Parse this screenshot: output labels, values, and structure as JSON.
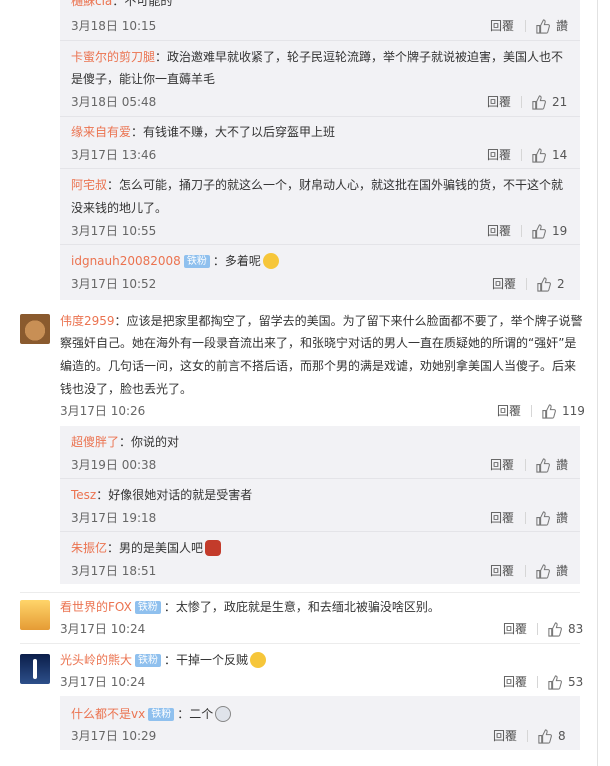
{
  "actions": {
    "reply_label": "回覆",
    "like_icon": "thumbs-up-icon"
  },
  "thread1_replies": [
    {
      "name": "樋蘇cia",
      "sep": "：",
      "text": "不可能的",
      "time": "3月18日 10:15",
      "likes": "讚"
    },
    {
      "name": "卡蜜尔的剪刀腿",
      "sep": "：",
      "text": "政治邀难早就收紧了，轮子民逗轮流蹲，举个牌子就说被迫害，美国人也不",
      "text2": "是傻子，能让你一直薅羊毛",
      "time": "3月18日 05:48",
      "likes": "21"
    },
    {
      "name": "缘来自有爱",
      "sep": "：",
      "text": "有钱谁不赚，大不了以后穿盔甲上班",
      "time": "3月17日 13:46",
      "likes": "14"
    },
    {
      "name": "阿宅叔",
      "sep": "：",
      "text": "怎么可能，捅刀子的就这么一个，财帛动人心，就这批在国外骗钱的货，不干这个就",
      "text2": "没来钱的地儿了。",
      "time": "3月17日 10:55",
      "likes": "19"
    },
    {
      "name": "idgnauh20082008",
      "badge": "铁粉",
      "sep": "：",
      "text": "多着呢",
      "emoji": "sleepy-face-icon",
      "time": "3月17日 10:52",
      "likes": "2"
    }
  ],
  "comment2": {
    "name": "伟度2959",
    "sep": "：",
    "lines": [
      "应该是把家里都掏空了，留学去的美国。为了留下来什么脸面都不要了，举个牌子说警",
      "察强奸自己。她在海外有一段录音流出来了，和张晓宁对话的男人一直在质疑她的所谓的“强奸”是",
      "编造的。几句话一问，这女的前言不搭后语，而那个男的满是戏谑，劝她别拿美国人当傻子。后来",
      "钱也没了，脸也丢光了。"
    ],
    "time": "3月17日 10:26",
    "likes": "119"
  },
  "thread2_replies": [
    {
      "name": "超傻胖了",
      "sep": "：",
      "text": "你说的对",
      "time": "3月19日 00:38",
      "likes": "讚"
    },
    {
      "name": "Tesz",
      "sep": "：",
      "text": "好像很她对话的就是受害者",
      "time": "3月17日 19:18",
      "likes": "讚"
    },
    {
      "name": "朱振亿",
      "sep": "：",
      "text": "男的是美国人吧",
      "emoji": "car-icon",
      "time": "3月17日 18:51",
      "likes": "讚"
    }
  ],
  "comment3": {
    "name": "看世界的FOX",
    "badge": "铁粉",
    "sep": "：",
    "text": "太惨了，政庇就是生意，和去缅北被骗没啥区别。",
    "time": "3月17日 10:24",
    "likes": "83"
  },
  "comment4": {
    "name": "光头岭的熊大",
    "badge": "铁粉",
    "sep": "：",
    "text": "干掉一个反贼",
    "emoji": "grin-face-icon",
    "time": "3月17日 10:24",
    "likes": "53"
  },
  "thread4_reply": {
    "name": "什么都不是vx",
    "badge": "铁粉",
    "sep": "：",
    "text": "二个",
    "emoji": "skull-face-icon",
    "time": "3月17日 10:29",
    "likes": "8"
  }
}
